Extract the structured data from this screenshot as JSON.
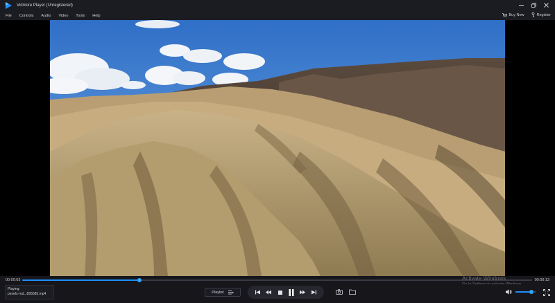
{
  "window": {
    "title": "Vidmore Player (Unregistered)",
    "logo_icon": "play-triangle-icon",
    "accent": "#1e90ff"
  },
  "menu": {
    "items": [
      "File",
      "Controls",
      "Audio",
      "Video",
      "Tools",
      "Help"
    ],
    "buy_now": "Buy Now",
    "register": "Register"
  },
  "video": {
    "description_icon": "landscape-video-frame"
  },
  "playback": {
    "current_time": "00:00:03",
    "total_time": "00:00:13",
    "progress_fraction": 0.23,
    "playing_label": "Playing:",
    "file_name": "pexels-rod...895585.mp4",
    "playlist_label": "Playlist",
    "volume_fraction": 0.75
  },
  "watermark": {
    "title": "Activate Windows",
    "subtitle": "Go to Settings to activate Windows."
  }
}
